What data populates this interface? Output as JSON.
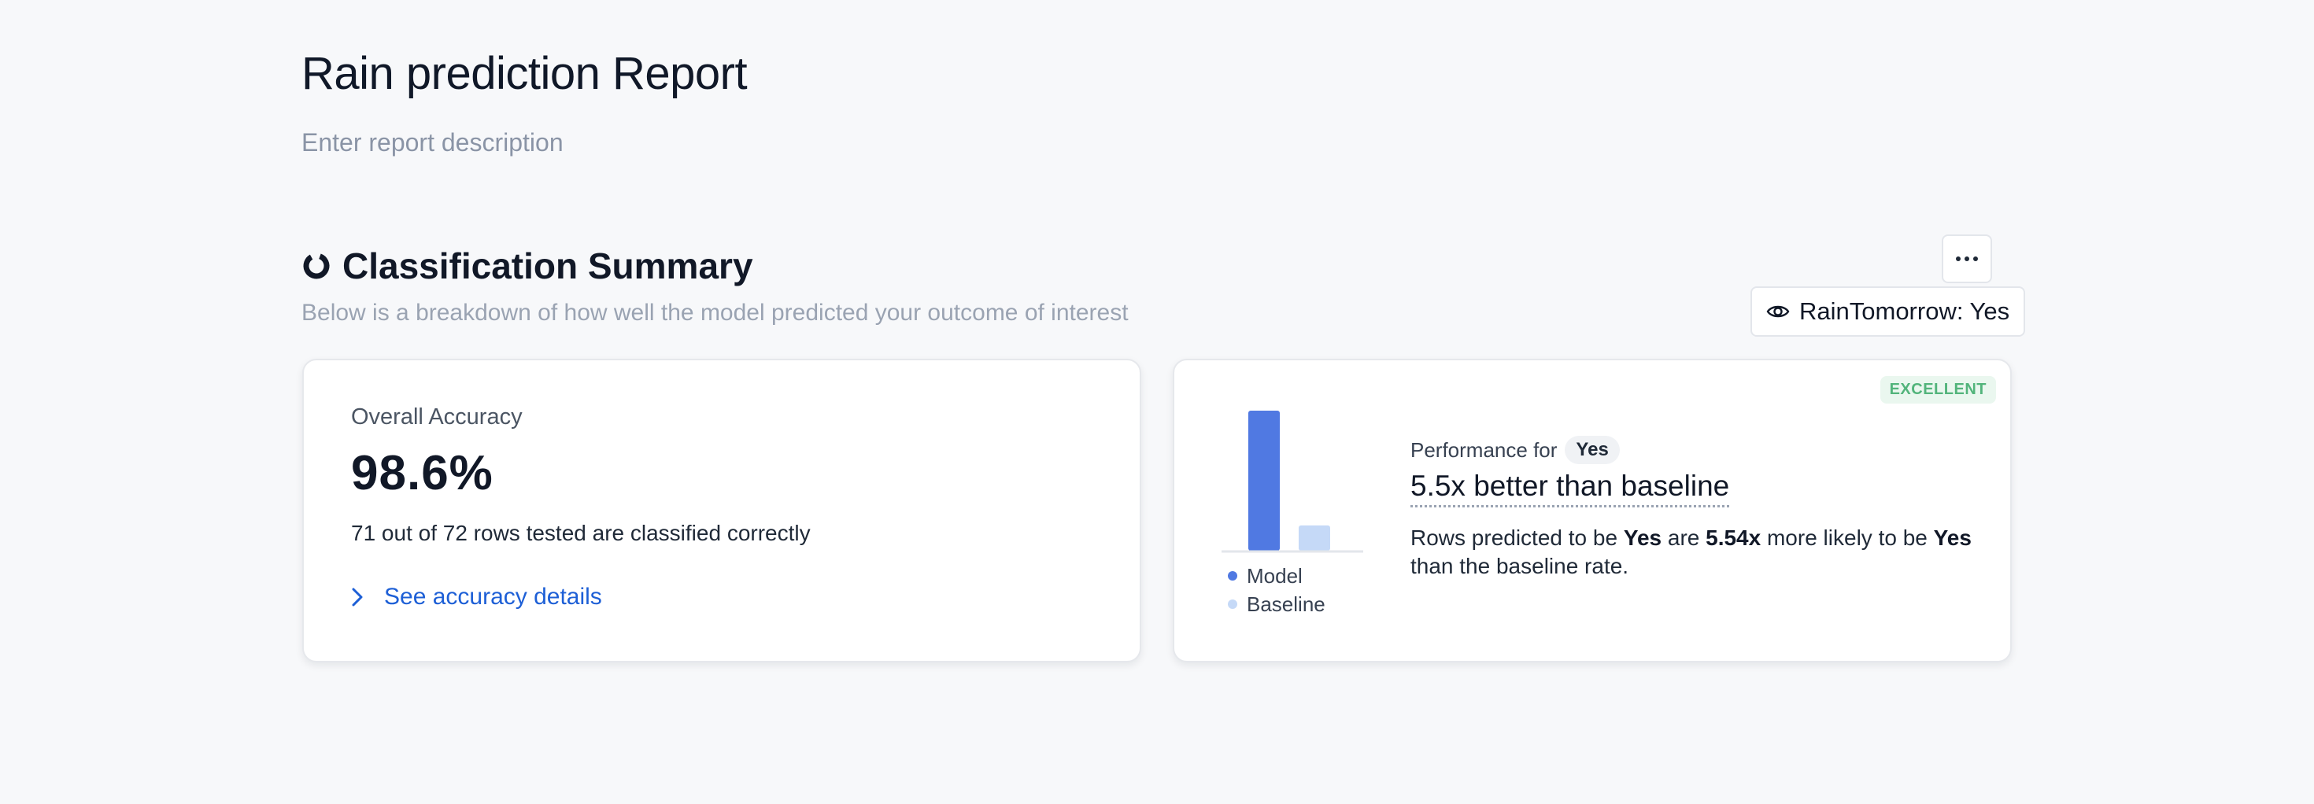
{
  "report": {
    "title": "Rain prediction Report",
    "description_placeholder": "Enter report description"
  },
  "section": {
    "title": "Classification Summary",
    "subtitle": "Below is a breakdown of how well the model predicted your outcome of interest",
    "icon": "donut-chart-icon",
    "more_icon": "more-horizontal-icon",
    "filter": {
      "icon": "eye-icon",
      "label": "RainTomorrow: Yes"
    }
  },
  "accuracy_card": {
    "label": "Overall Accuracy",
    "value": "98.6%",
    "description": "71 out of 72 rows tested are classified correctly",
    "link_label": "See accuracy details",
    "link_icon": "chevron-right-icon"
  },
  "performance_card": {
    "badge": "EXCELLENT",
    "performance_for_label": "Performance for",
    "performance_for_value": "Yes",
    "headline": "5.5x better than baseline",
    "body": {
      "part1": "Rows predicted to be ",
      "bold1": "Yes",
      "part2": " are ",
      "bold2": "5.54x",
      "part3": " more likely to be ",
      "bold3": "Yes",
      "part4": " than the baseline rate."
    },
    "legend": {
      "model": "Model",
      "baseline": "Baseline"
    }
  },
  "colors": {
    "model": "#5079e2",
    "baseline": "#c5d9f7",
    "link": "#1d5fd6",
    "badge_text": "#52b47b",
    "badge_bg": "#eaf7ef"
  },
  "chart_data": {
    "type": "bar",
    "categories": [
      "Model",
      "Baseline"
    ],
    "values": [
      5.54,
      1
    ],
    "title": "",
    "xlabel": "",
    "ylabel": "",
    "ylim": [
      0,
      5.54
    ],
    "grid": false,
    "legend": "bottom"
  }
}
